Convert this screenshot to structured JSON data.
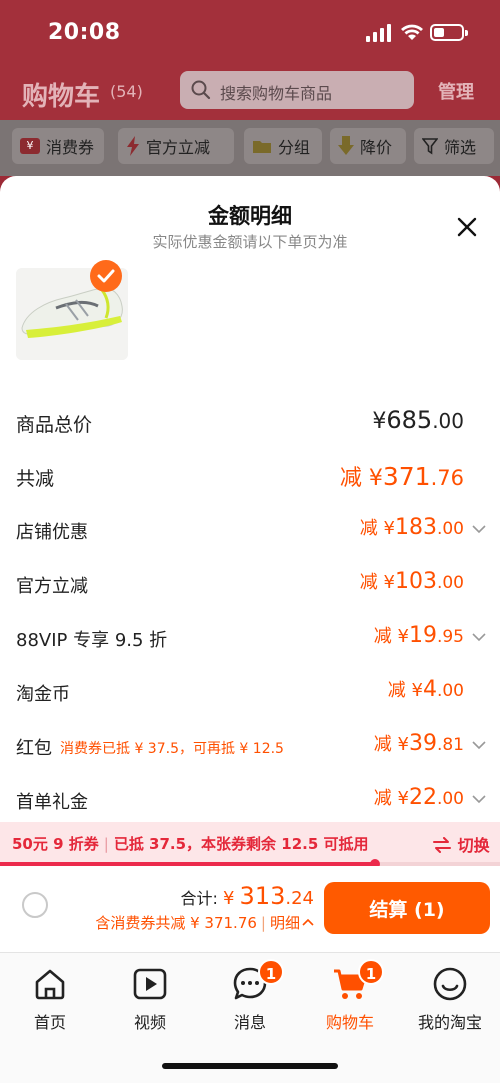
{
  "status_bar": {
    "time": "20:08"
  },
  "header": {
    "title": "购物车",
    "count": "(54)",
    "search_placeholder": "搜索购物车商品",
    "manage": "管理"
  },
  "filters": [
    {
      "label": "消费券",
      "icon": "coupon-icon"
    },
    {
      "label": "官方立减",
      "icon": "lightning-icon"
    },
    {
      "label": "分组",
      "icon": "folder-icon"
    },
    {
      "label": "降价",
      "icon": "down-arrow-icon"
    },
    {
      "label": "筛选",
      "icon": "filter-icon"
    }
  ],
  "sheet": {
    "title": "金额明细",
    "subtitle": "实际优惠金额请以下单页为准",
    "product_image": "white-running-shoe"
  },
  "price_rows": [
    {
      "label": "商品总价",
      "prefix": "",
      "yen": "¥",
      "int": "685",
      "dec": ".00",
      "arrow": false
    },
    {
      "label": "共减",
      "prefix": "减 ",
      "yen": "¥",
      "int": "371",
      "dec": ".76",
      "arrow": false
    },
    {
      "label": "店铺优惠",
      "prefix": "减 ",
      "yen": "¥",
      "int": "183",
      "dec": ".00",
      "arrow": true
    },
    {
      "label": "官方立减",
      "prefix": "减 ",
      "yen": "¥",
      "int": "103",
      "dec": ".00",
      "arrow": false
    },
    {
      "label": "88VIP 专享 9.5 折",
      "prefix": "减 ",
      "yen": "¥",
      "int": "19",
      "dec": ".95",
      "arrow": true
    },
    {
      "label": "淘金币",
      "prefix": "减 ",
      "yen": "¥",
      "int": "4",
      "dec": ".00",
      "arrow": false
    },
    {
      "label": "红包",
      "note": "消费券已抵 ¥ 37.5，可再抵 ¥ 12.5",
      "prefix": "减 ",
      "yen": "¥",
      "int": "39",
      "dec": ".81",
      "arrow": true
    },
    {
      "label": "首单礼金",
      "prefix": "减 ",
      "yen": "¥",
      "int": "22",
      "dec": ".00",
      "arrow": true
    }
  ],
  "coupon_strip": {
    "name": "50元 9 折券",
    "status": "已抵 37.5，本张券剩余 12.5 可抵用",
    "switch": "切换",
    "used_fraction": 0.75
  },
  "checkout": {
    "total_label": "合计:",
    "total_yen": "¥",
    "total_int": "313",
    "total_dec": ".24",
    "sub_text": "含消费券共减 ¥ 371.76",
    "detail_link": "明细",
    "pay_button": "结算 (1)"
  },
  "tabs": [
    {
      "label": "首页",
      "icon": "home-icon",
      "badge": ""
    },
    {
      "label": "视频",
      "icon": "video-icon",
      "badge": ""
    },
    {
      "label": "消息",
      "icon": "message-icon",
      "badge": "1"
    },
    {
      "label": "购物车",
      "icon": "cart-icon",
      "badge": "1"
    },
    {
      "label": "我的淘宝",
      "icon": "profile-icon",
      "badge": ""
    }
  ],
  "colors": {
    "accent": "#ff5000",
    "coupon_red": "#e4283a",
    "header_bg": "#a3303b"
  }
}
